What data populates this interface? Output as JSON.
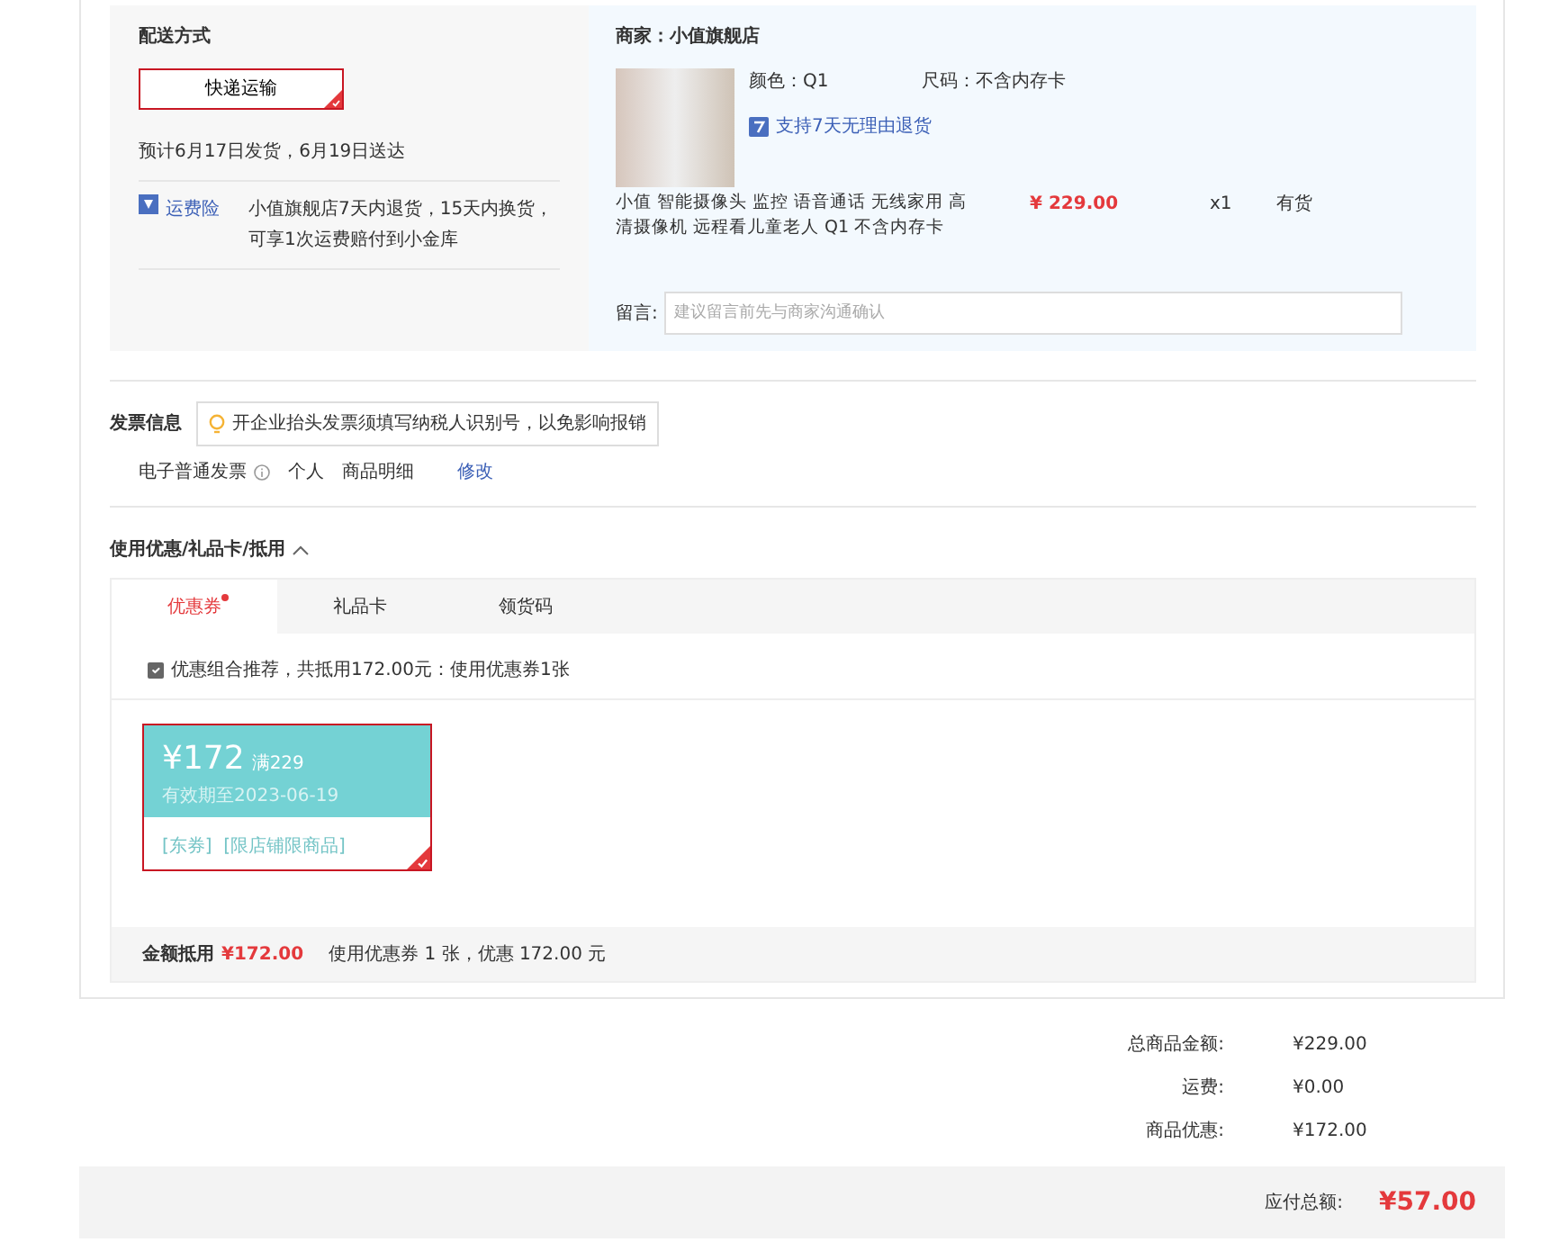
{
  "delivery": {
    "title": "配送方式",
    "options": [
      {
        "label": "快递运输",
        "selected": true
      }
    ],
    "estimate": "预计6月17日发货，6月19日送达",
    "insurance_label": "运费险",
    "insurance_text": "小值旗舰店7天内退货，15天内换货，可享1次运费赔付到小金库"
  },
  "shop": {
    "name_label": "商家：",
    "name": "小值旗舰店",
    "color_label": "颜色：",
    "color_option": "Q1",
    "size_label": "尺码：",
    "size": "不含内存卡",
    "return_policy": "支持7天无理由退货",
    "product_name": "小值 智能摄像头 监控 语音通话 无线家用 高清摄像机 远程看儿童老人 Q1 不含内存卡",
    "price": "¥ 229.00",
    "quantity": "x1",
    "stock": "有货",
    "note_label": "留言:",
    "note_placeholder": "建议留言前先与商家沟通确认"
  },
  "invoice": {
    "title": "发票信息",
    "tip": "开企业抬头发票须填写纳税人识别号，以免影响报销",
    "type": "电子普通发票",
    "header": "个人",
    "content": "商品明细",
    "edit": "修改"
  },
  "discounts": {
    "title": "使用优惠/礼品卡/抵用",
    "expanded": true,
    "tabs": [
      {
        "label": "优惠券",
        "selected": true,
        "dot": true
      },
      {
        "label": "礼品卡",
        "selected": false,
        "dot": false
      },
      {
        "label": "领货码",
        "selected": false,
        "dot": false
      }
    ],
    "recommend": {
      "checked": true,
      "text": "优惠组合推荐，共抵用172.00元：使用优惠券1张"
    },
    "coupons": [
      {
        "amount": "¥172",
        "condition": "满229",
        "validity": "有效期至2023-06-19",
        "tags": "[东券]  [限店铺限商品]",
        "selected": true
      }
    ],
    "summary_label": "金额抵用",
    "summary_amount": "¥172.00",
    "summary_text": "使用优惠券 1 张，优惠 172.00 元"
  },
  "totals": [
    {
      "label": "总商品金额:",
      "value": "¥229.00"
    },
    {
      "label": "运费:",
      "value": "¥0.00"
    },
    {
      "label": "商品优惠:",
      "value": "¥172.00"
    }
  ],
  "payable": {
    "label": "应付总额:",
    "value": "¥57.00"
  }
}
